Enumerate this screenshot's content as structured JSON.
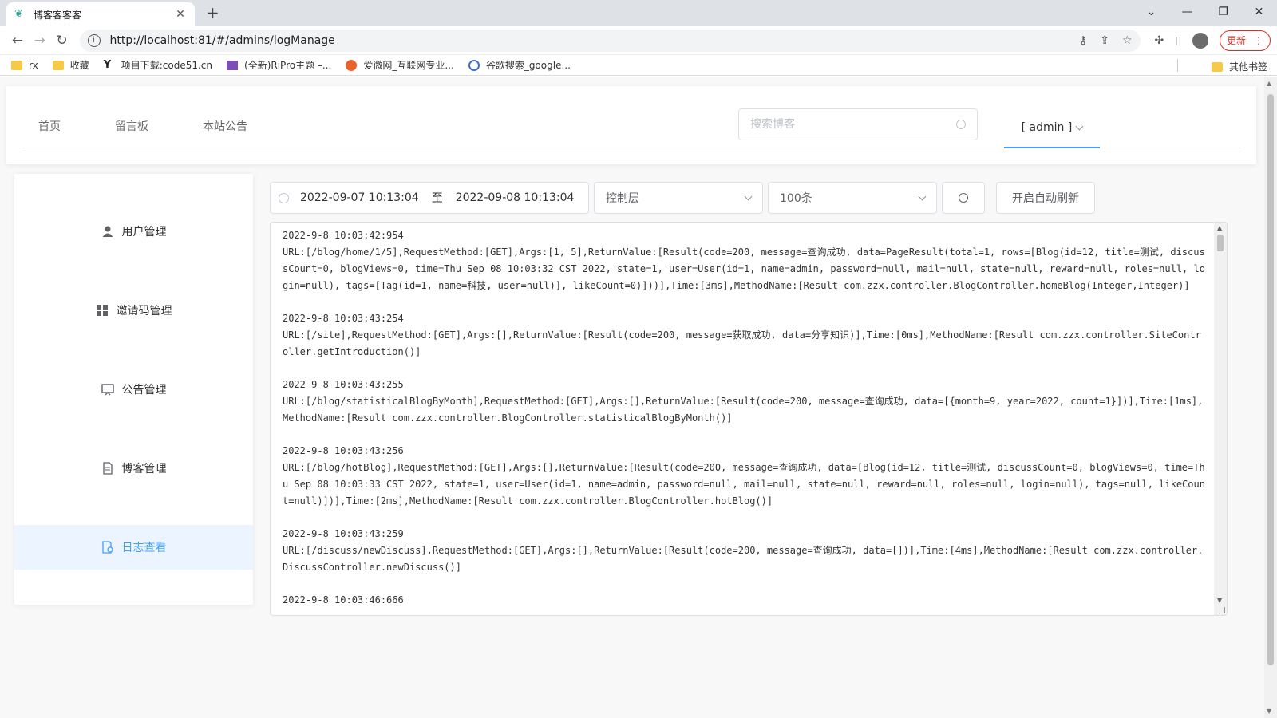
{
  "browser": {
    "tab_title": "博客客客客",
    "url": "http://localhost:81/#/admins/logManage",
    "update_label": "更新",
    "bookmarks": [
      "rx",
      "收藏",
      "项目下载:code51.cn",
      "(全新)RiPro主题 –...",
      "爱微网_互联网专业...",
      "谷歌搜索_google..."
    ],
    "other_bookmarks": "其他书签"
  },
  "header": {
    "menu": [
      "首页",
      "留言板",
      "本站公告"
    ],
    "search_placeholder": "搜索博客",
    "user_label": "[ admin ]"
  },
  "sidebar": {
    "items": [
      {
        "label": "用户管理",
        "icon": "user-icon",
        "active": false
      },
      {
        "label": "邀请码管理",
        "icon": "grid-icon",
        "active": false
      },
      {
        "label": "公告管理",
        "icon": "monitor-icon",
        "active": false
      },
      {
        "label": "博客管理",
        "icon": "document-icon",
        "active": false
      },
      {
        "label": "日志查看",
        "icon": "log-icon",
        "active": true
      }
    ]
  },
  "filters": {
    "start_date": "2022-09-07 10:13:04",
    "range_separator": "至",
    "end_date": "2022-09-08 10:13:04",
    "layer": "控制层",
    "count": "100条",
    "auto_refresh_label": "开启自动刷新"
  },
  "logs": [
    {
      "ts": "2022-9-8 10:03:42:954",
      "msg": "URL:[/blog/home/1/5],RequestMethod:[GET],Args:[1, 5],ReturnValue:[Result(code=200, message=查询成功, data=PageResult(total=1, rows=[Blog(id=12, title=测试, discussCount=0, blogViews=0, time=Thu Sep 08 10:03:32 CST 2022, state=1, user=User(id=1, name=admin, password=null, mail=null, state=null, reward=null, roles=null, login=null), tags=[Tag(id=1, name=科技, user=null)], likeCount=0)]))],Time:[3ms],MethodName:[Result com.zzx.controller.BlogController.homeBlog(Integer,Integer)]"
    },
    {
      "ts": "2022-9-8 10:03:43:254",
      "msg": "URL:[/site],RequestMethod:[GET],Args:[],ReturnValue:[Result(code=200, message=获取成功, data=分享知识)],Time:[0ms],MethodName:[Result com.zzx.controller.SiteController.getIntroduction()]"
    },
    {
      "ts": "2022-9-8 10:03:43:255",
      "msg": "URL:[/blog/statisticalBlogByMonth],RequestMethod:[GET],Args:[],ReturnValue:[Result(code=200, message=查询成功, data=[{month=9, year=2022, count=1}])],Time:[1ms],MethodName:[Result com.zzx.controller.BlogController.statisticalBlogByMonth()]"
    },
    {
      "ts": "2022-9-8 10:03:43:256",
      "msg": "URL:[/blog/hotBlog],RequestMethod:[GET],Args:[],ReturnValue:[Result(code=200, message=查询成功, data=[Blog(id=12, title=测试, discussCount=0, blogViews=0, time=Thu Sep 08 10:03:33 CST 2022, state=1, user=User(id=1, name=admin, password=null, mail=null, state=null, reward=null, roles=null, login=null), tags=null, likeCount=null)])],Time:[2ms],MethodName:[Result com.zzx.controller.BlogController.hotBlog()]"
    },
    {
      "ts": "2022-9-8 10:03:43:259",
      "msg": "URL:[/discuss/newDiscuss],RequestMethod:[GET],Args:[],ReturnValue:[Result(code=200, message=查询成功, data=[])],Time:[4ms],MethodName:[Result com.zzx.controller.DiscussController.newDiscuss()]"
    },
    {
      "ts": "2022-9-8 10:03:46:666",
      "msg": ""
    }
  ]
}
